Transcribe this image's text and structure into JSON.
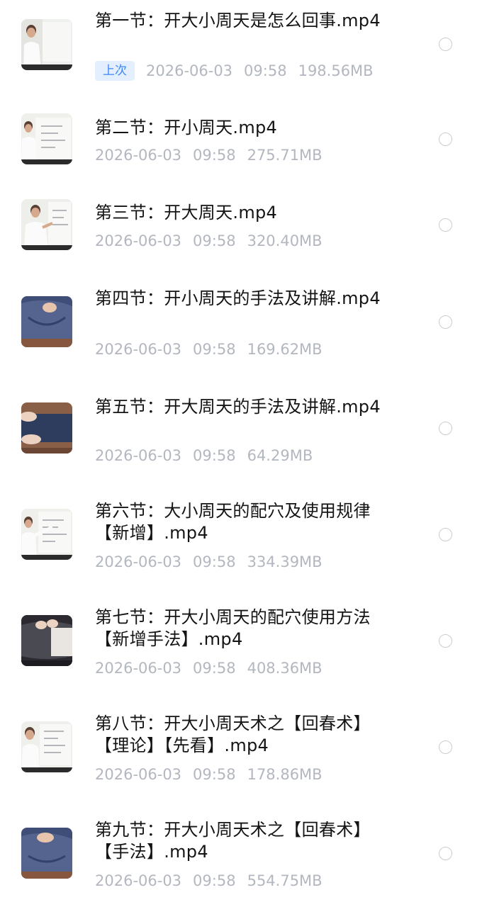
{
  "files": [
    {
      "name": "第一节：开大小周天是怎么回事.mp4",
      "badge": "上次",
      "date": "2026-06-03",
      "time": "09:58",
      "size": "198.56MB",
      "thumb_icon": "video-thumbnail-whiteboard-lecture-icon"
    },
    {
      "name": "第二节：开小周天.mp4",
      "date": "2026-06-03",
      "time": "09:58",
      "size": "275.71MB",
      "thumb_icon": "video-thumbnail-whiteboard-lecture-icon"
    },
    {
      "name": "第三节：开大周天.mp4",
      "date": "2026-06-03",
      "time": "09:58",
      "size": "320.40MB",
      "thumb_icon": "video-thumbnail-whiteboard-lecture-icon"
    },
    {
      "name": "第四节：开小周天的手法及讲解.mp4",
      "date": "2026-06-03",
      "time": "09:58",
      "size": "169.62MB",
      "thumb_icon": "video-thumbnail-massage-icon"
    },
    {
      "name": "第五节：开大周天的手法及讲解.mp4",
      "date": "2026-06-03",
      "time": "09:58",
      "size": "64.29MB",
      "thumb_icon": "video-thumbnail-massage-legs-icon"
    },
    {
      "name": "第六节：大小周天的配穴及使用规律【新增】.mp4",
      "date": "2026-06-03",
      "time": "09:58",
      "size": "334.39MB",
      "thumb_icon": "video-thumbnail-whiteboard-lecture-icon"
    },
    {
      "name": "第七节：开大小周天的配穴使用方法【新增手法】.mp4",
      "date": "2026-06-03",
      "time": "09:58",
      "size": "408.36MB",
      "thumb_icon": "video-thumbnail-massage-back-icon"
    },
    {
      "name": "第八节：开大小周天术之【回春术】【理论】【先看】.mp4",
      "date": "2026-06-03",
      "time": "09:58",
      "size": "178.86MB",
      "thumb_icon": "video-thumbnail-whiteboard-lecture-icon"
    },
    {
      "name": "第九节：开大小周天术之【回春术】【手法】.mp4",
      "date": "2026-06-03",
      "time": "09:58",
      "size": "554.75MB",
      "thumb_icon": "video-thumbnail-massage-icon"
    }
  ],
  "colors": {
    "title": "#141414",
    "meta": "#b3b7bf",
    "badge_bg": "#e3efff",
    "badge_text": "#3b86f5",
    "radio_border": "#c9cdd2"
  }
}
